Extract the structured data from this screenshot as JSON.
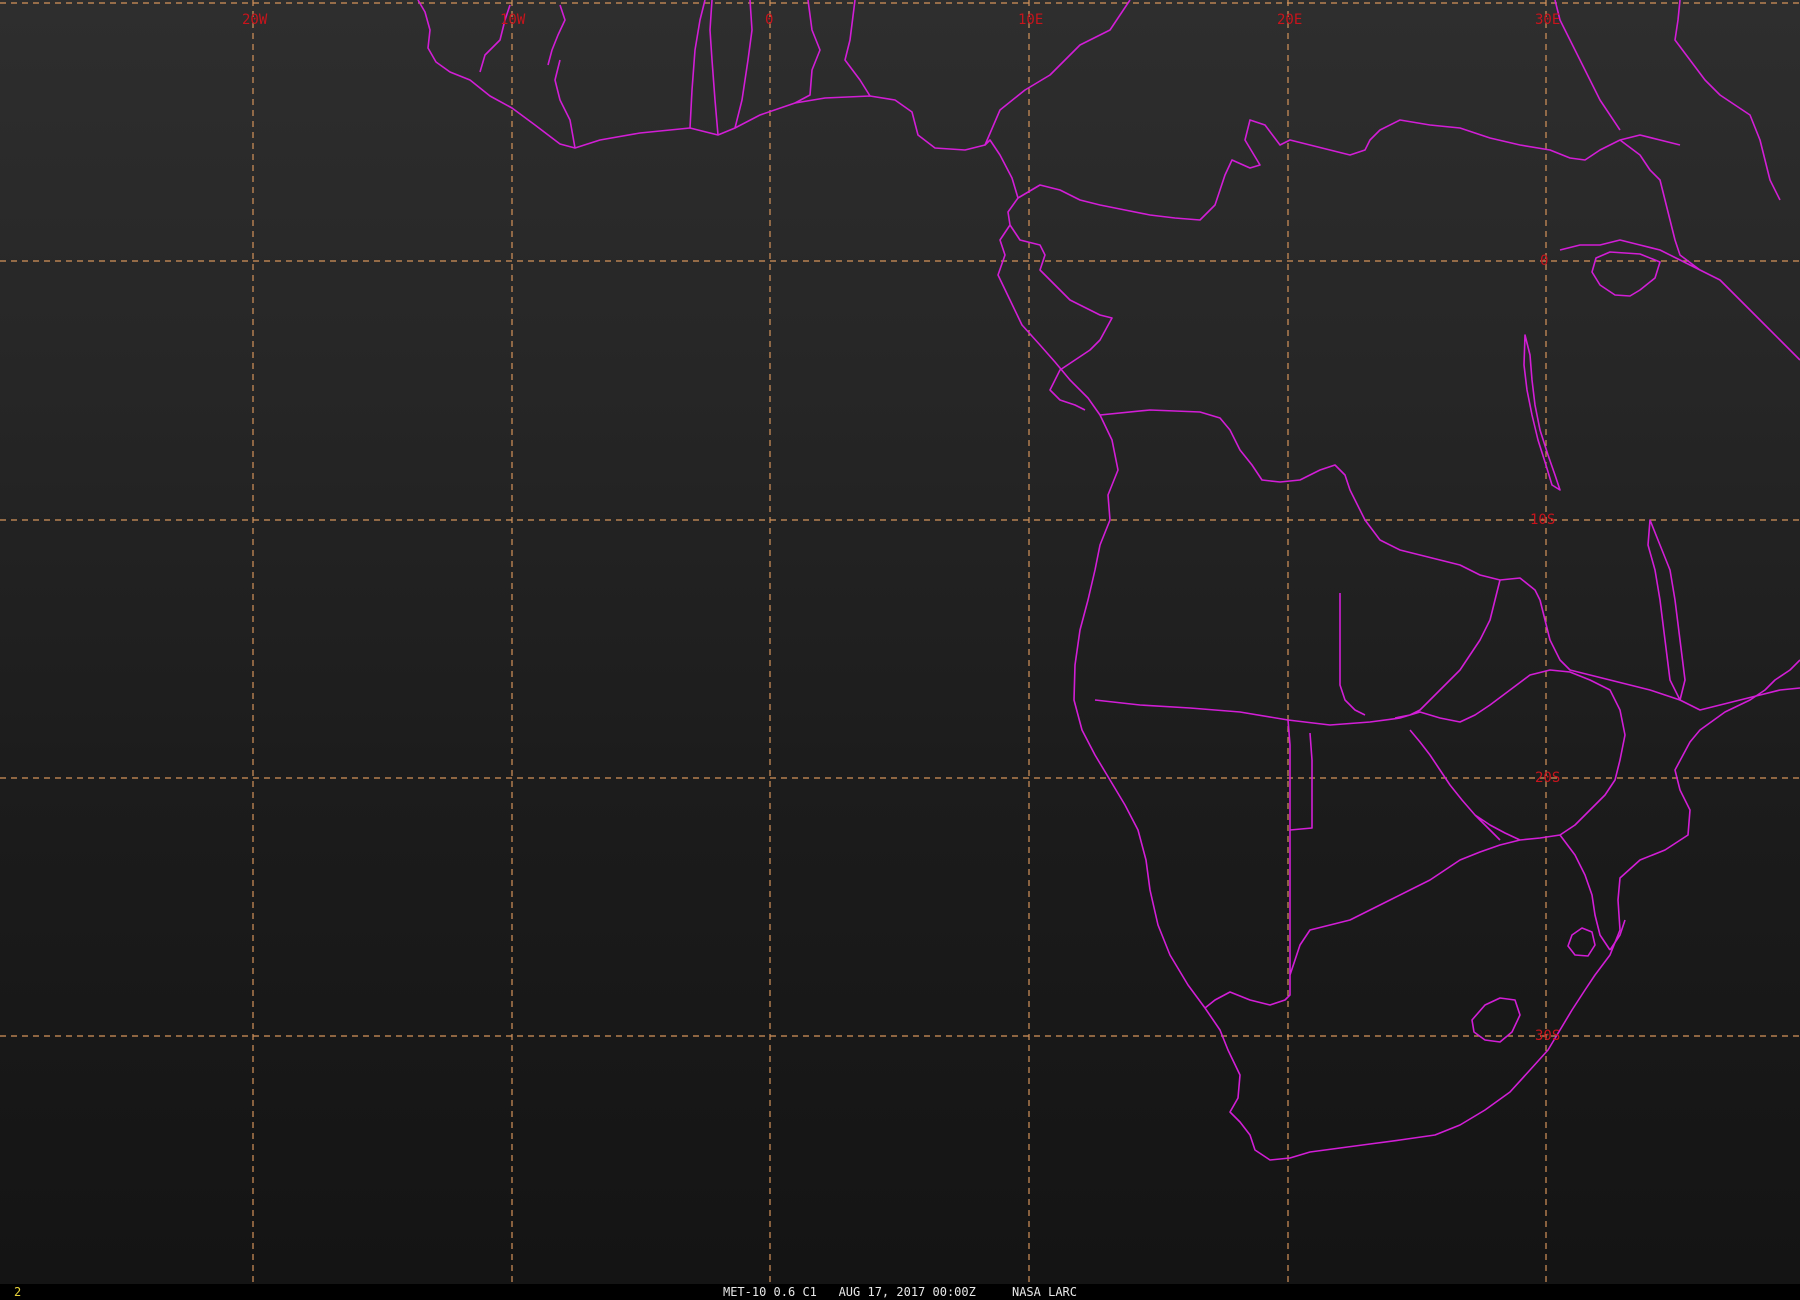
{
  "map": {
    "longitude_labels": [
      "20W",
      "10W",
      "0",
      "10E",
      "20E",
      "30E"
    ],
    "latitude_labels": [
      "0",
      "10S",
      "20S",
      "30S"
    ],
    "colors": {
      "grid": "#d4935a",
      "boundaries": "#d21ed6",
      "labels": "#c8141c"
    }
  },
  "footer": {
    "frame_number": "2",
    "caption": "MET-10 0.6 C1   AUG 17, 2017 00:00Z     NASA LARC"
  }
}
